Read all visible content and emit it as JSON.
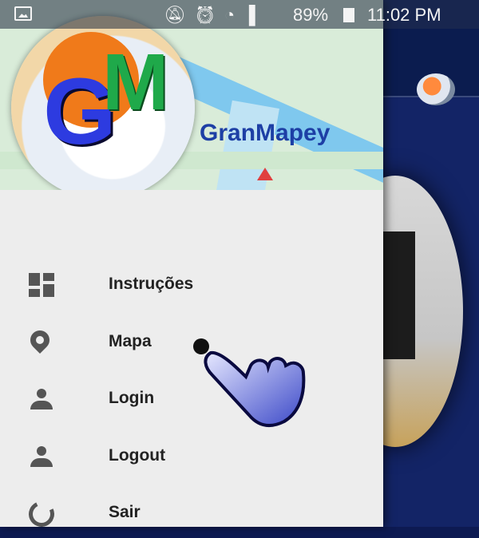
{
  "status_bar": {
    "battery_percent": "89%",
    "time": "11:02 PM",
    "icons": [
      "image-icon",
      "mute-icon",
      "alarm-icon",
      "wifi-icon",
      "signal-icon",
      "battery-icon"
    ]
  },
  "drawer": {
    "header": {
      "logo_letters": [
        "G",
        "M"
      ],
      "app_name": "GranMapey"
    },
    "items": [
      {
        "label": "Instruções",
        "icon": "dashboard-icon"
      },
      {
        "label": "Mapa",
        "icon": "place-icon"
      },
      {
        "label": "Login",
        "icon": "person-icon"
      },
      {
        "label": "Logout",
        "icon": "person-icon"
      },
      {
        "label": "Sair",
        "icon": "exit-icon"
      }
    ]
  },
  "colors": {
    "drawer_bg": "#ededed",
    "brand_blue": "#1d3fa5",
    "app_toolbar": "#0b1c4f"
  }
}
